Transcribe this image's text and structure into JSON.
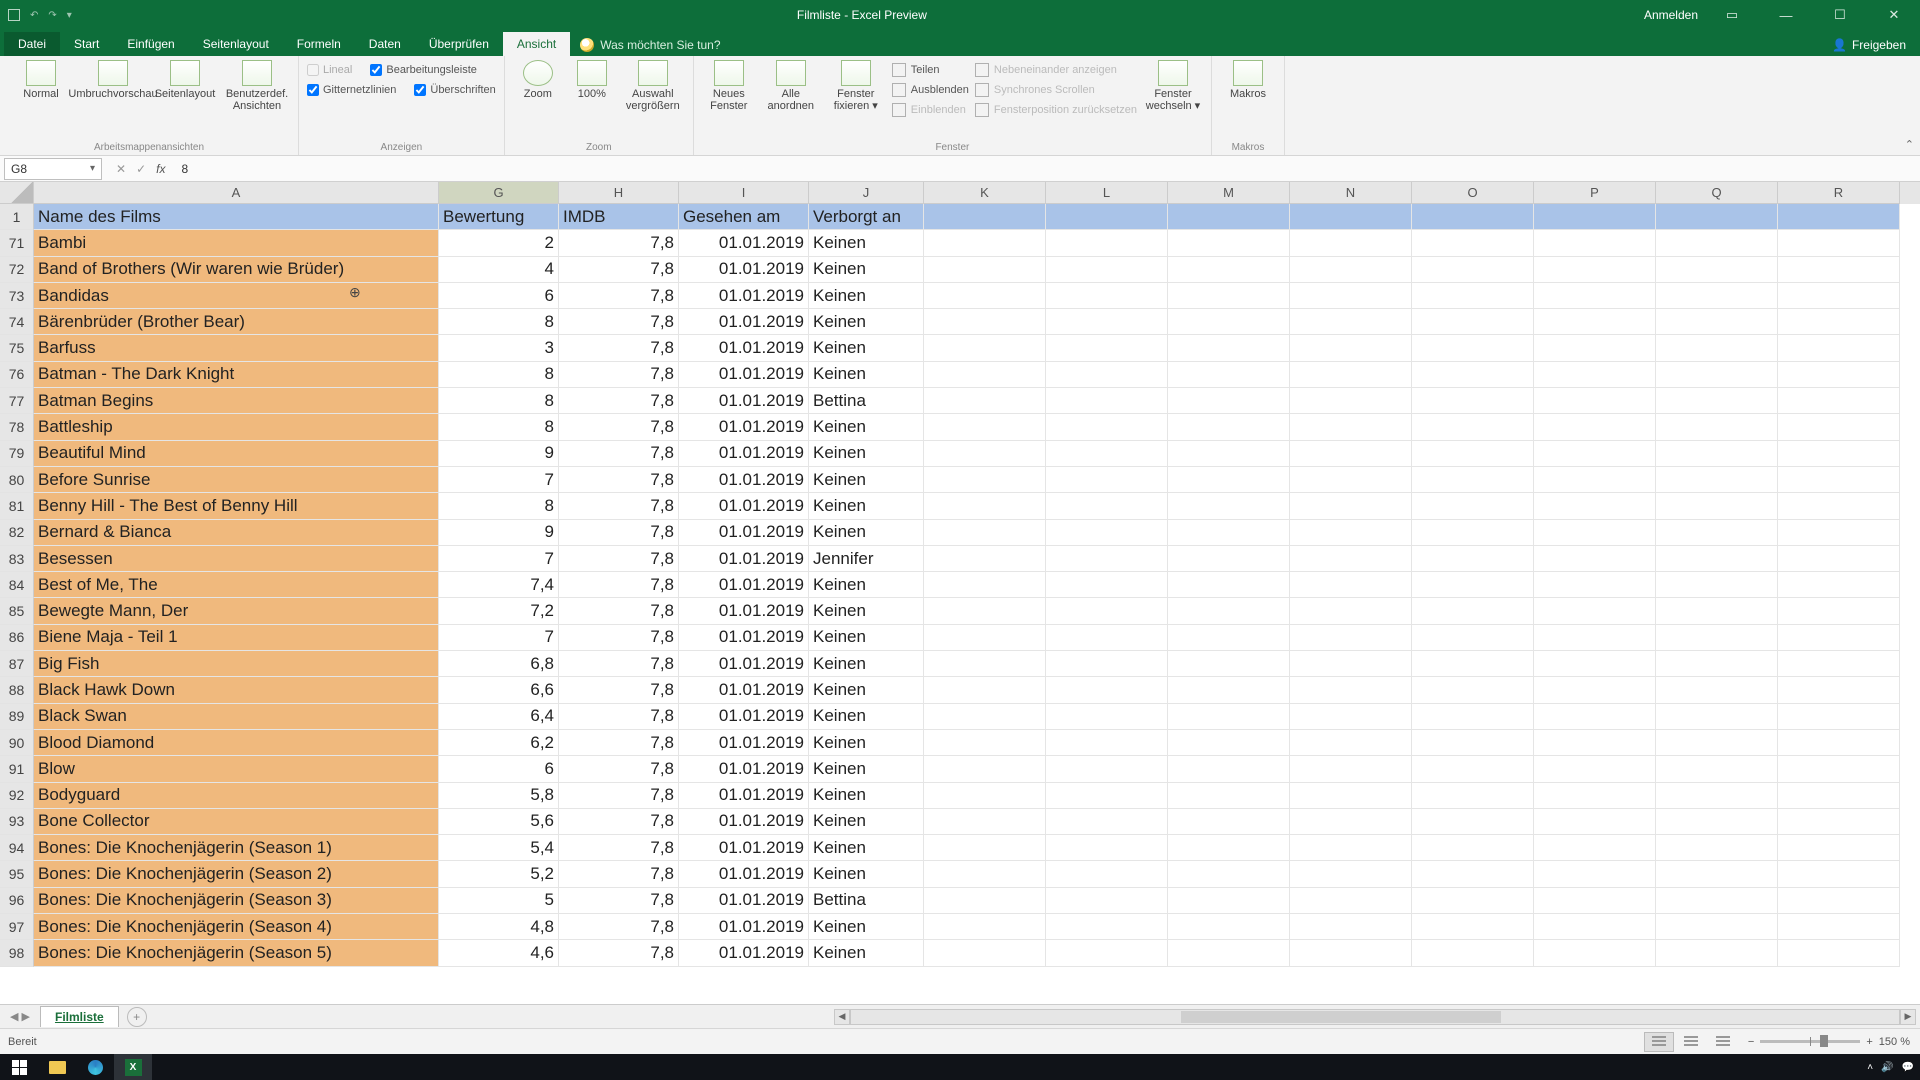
{
  "titlebar": {
    "title": "Filmliste  -  Excel Preview",
    "signin": "Anmelden"
  },
  "tabs": {
    "file": "Datei",
    "list": [
      "Start",
      "Einfügen",
      "Seitenlayout",
      "Formeln",
      "Daten",
      "Überprüfen",
      "Ansicht"
    ],
    "active": "Ansicht",
    "tellme": "Was möchten Sie tun?",
    "share": "Freigeben"
  },
  "ribbon": {
    "views": {
      "normal": "Normal",
      "umbruch": "Umbruchvorschau",
      "seitenlayout": "Seitenlayout",
      "benutzerdef": "Benutzerdef.\nAnsichten",
      "group": "Arbeitsmappenansichten"
    },
    "show": {
      "lineal": "Lineal",
      "bearbeitungsleiste": "Bearbeitungsleiste",
      "gitternetzlinien": "Gitternetzlinien",
      "ueberschriften": "Überschriften",
      "group": "Anzeigen"
    },
    "zoom": {
      "zoom": "Zoom",
      "hundred": "100%",
      "selection": "Auswahl\nvergrößern",
      "group": "Zoom"
    },
    "window": {
      "neu": "Neues\nFenster",
      "alle": "Alle\nanordnen",
      "fixieren": "Fenster\nfixieren ▾",
      "teilen": "Teilen",
      "ausblenden": "Ausblenden",
      "einblenden": "Einblenden",
      "nebeneinander": "Nebeneinander anzeigen",
      "synchron": "Synchrones Scrollen",
      "reset": "Fensterposition zurücksetzen",
      "wechseln": "Fenster\nwechseln ▾",
      "group": "Fenster"
    },
    "macros": {
      "makros": "Makros",
      "group": "Makros"
    }
  },
  "formulabar": {
    "name": "G8",
    "fx": "fx",
    "value": "8"
  },
  "columns": [
    "A",
    "G",
    "H",
    "I",
    "J",
    "K",
    "L",
    "M",
    "N",
    "O",
    "P",
    "Q",
    "R"
  ],
  "header": {
    "a": "Name des Films",
    "g": "Bewertung",
    "h": "IMDB",
    "i": "Gesehen am",
    "j": "Verborgt an"
  },
  "rows": [
    {
      "n": 71,
      "a": "Bambi",
      "g": "2",
      "h": "7,8",
      "i": "01.01.2019",
      "j": "Keinen"
    },
    {
      "n": 72,
      "a": "Band of Brothers (Wir waren wie Brüder)",
      "g": "4",
      "h": "7,8",
      "i": "01.01.2019",
      "j": "Keinen"
    },
    {
      "n": 73,
      "a": "Bandidas",
      "g": "6",
      "h": "7,8",
      "i": "01.01.2019",
      "j": "Keinen"
    },
    {
      "n": 74,
      "a": "Bärenbrüder (Brother Bear)",
      "g": "8",
      "h": "7,8",
      "i": "01.01.2019",
      "j": "Keinen"
    },
    {
      "n": 75,
      "a": "Barfuss",
      "g": "3",
      "h": "7,8",
      "i": "01.01.2019",
      "j": "Keinen"
    },
    {
      "n": 76,
      "a": "Batman - The Dark Knight",
      "g": "8",
      "h": "7,8",
      "i": "01.01.2019",
      "j": "Keinen"
    },
    {
      "n": 77,
      "a": "Batman Begins",
      "g": "8",
      "h": "7,8",
      "i": "01.01.2019",
      "j": "Bettina"
    },
    {
      "n": 78,
      "a": "Battleship",
      "g": "8",
      "h": "7,8",
      "i": "01.01.2019",
      "j": "Keinen"
    },
    {
      "n": 79,
      "a": "Beautiful Mind",
      "g": "9",
      "h": "7,8",
      "i": "01.01.2019",
      "j": "Keinen"
    },
    {
      "n": 80,
      "a": "Before Sunrise",
      "g": "7",
      "h": "7,8",
      "i": "01.01.2019",
      "j": "Keinen"
    },
    {
      "n": 81,
      "a": "Benny Hill - The Best of Benny Hill",
      "g": "8",
      "h": "7,8",
      "i": "01.01.2019",
      "j": "Keinen"
    },
    {
      "n": 82,
      "a": "Bernard & Bianca",
      "g": "9",
      "h": "7,8",
      "i": "01.01.2019",
      "j": "Keinen"
    },
    {
      "n": 83,
      "a": "Besessen",
      "g": "7",
      "h": "7,8",
      "i": "01.01.2019",
      "j": "Jennifer"
    },
    {
      "n": 84,
      "a": "Best of Me, The",
      "g": "7,4",
      "h": "7,8",
      "i": "01.01.2019",
      "j": "Keinen"
    },
    {
      "n": 85,
      "a": "Bewegte Mann, Der",
      "g": "7,2",
      "h": "7,8",
      "i": "01.01.2019",
      "j": "Keinen"
    },
    {
      "n": 86,
      "a": "Biene Maja - Teil 1",
      "g": "7",
      "h": "7,8",
      "i": "01.01.2019",
      "j": "Keinen"
    },
    {
      "n": 87,
      "a": "Big Fish",
      "g": "6,8",
      "h": "7,8",
      "i": "01.01.2019",
      "j": "Keinen"
    },
    {
      "n": 88,
      "a": "Black Hawk Down",
      "g": "6,6",
      "h": "7,8",
      "i": "01.01.2019",
      "j": "Keinen"
    },
    {
      "n": 89,
      "a": "Black Swan",
      "g": "6,4",
      "h": "7,8",
      "i": "01.01.2019",
      "j": "Keinen"
    },
    {
      "n": 90,
      "a": "Blood Diamond",
      "g": "6,2",
      "h": "7,8",
      "i": "01.01.2019",
      "j": "Keinen"
    },
    {
      "n": 91,
      "a": "Blow",
      "g": "6",
      "h": "7,8",
      "i": "01.01.2019",
      "j": "Keinen"
    },
    {
      "n": 92,
      "a": "Bodyguard",
      "g": "5,8",
      "h": "7,8",
      "i": "01.01.2019",
      "j": "Keinen"
    },
    {
      "n": 93,
      "a": "Bone Collector",
      "g": "5,6",
      "h": "7,8",
      "i": "01.01.2019",
      "j": "Keinen"
    },
    {
      "n": 94,
      "a": "Bones: Die Knochenjägerin (Season 1)",
      "g": "5,4",
      "h": "7,8",
      "i": "01.01.2019",
      "j": "Keinen"
    },
    {
      "n": 95,
      "a": "Bones: Die Knochenjägerin (Season 2)",
      "g": "5,2",
      "h": "7,8",
      "i": "01.01.2019",
      "j": "Keinen"
    },
    {
      "n": 96,
      "a": "Bones: Die Knochenjägerin (Season 3)",
      "g": "5",
      "h": "7,8",
      "i": "01.01.2019",
      "j": "Bettina"
    },
    {
      "n": 97,
      "a": "Bones: Die Knochenjägerin (Season 4)",
      "g": "4,8",
      "h": "7,8",
      "i": "01.01.2019",
      "j": "Keinen"
    },
    {
      "n": 98,
      "a": "Bones: Die Knochenjägerin (Season 5)",
      "g": "4,6",
      "h": "7,8",
      "i": "01.01.2019",
      "j": "Keinen"
    }
  ],
  "sheet": {
    "tab": "Filmliste"
  },
  "status": {
    "ready": "Bereit",
    "zoom": "150 %"
  }
}
